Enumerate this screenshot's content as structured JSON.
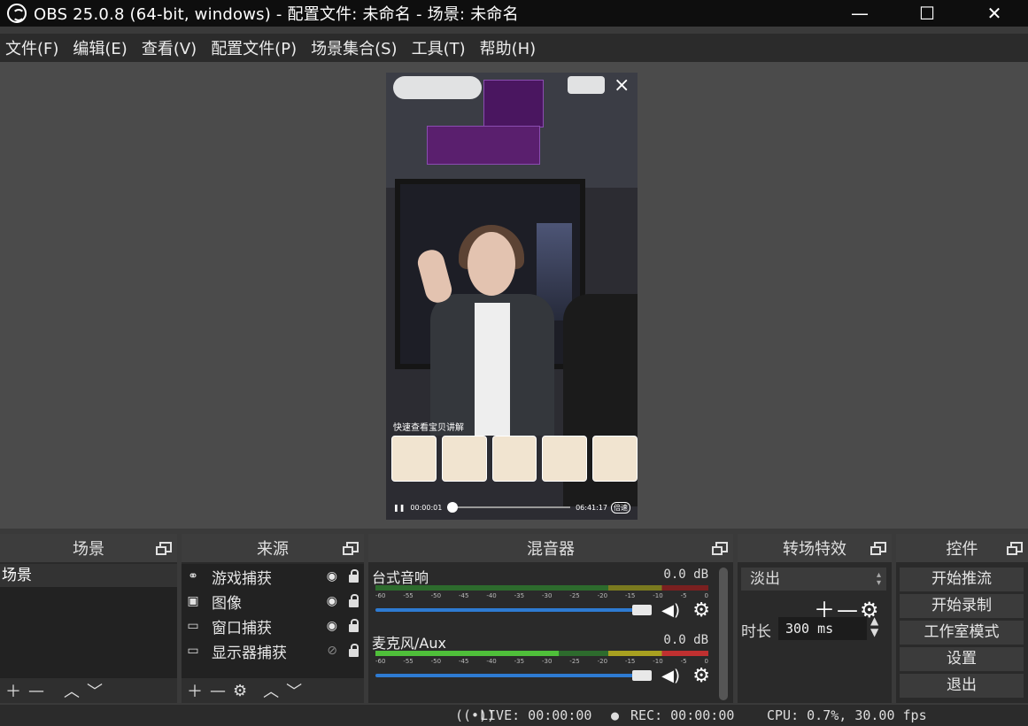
{
  "window": {
    "title": "OBS 25.0.8 (64-bit, windows) - 配置文件: 未命名 - 场景: 未命名",
    "minimize": "—",
    "maximize": "☐",
    "close": "✕"
  },
  "menu": [
    "文件(F)",
    "编辑(E)",
    "查看(V)",
    "配置文件(P)",
    "场景集合(S)",
    "工具(T)",
    "帮助(H)"
  ],
  "preview": {
    "caption": "快速查看宝贝讲解",
    "time_current": "00:00:01",
    "time_total": "06:41:17",
    "speed": "倍速",
    "progress": 0.0
  },
  "docks": {
    "scenes": {
      "title": "场景",
      "items": [
        "场景"
      ]
    },
    "sources": {
      "title": "来源",
      "items": [
        {
          "name": "游戏捕获",
          "icon": "gamepad-icon",
          "visible": true
        },
        {
          "name": "图像",
          "icon": "image-icon",
          "visible": true
        },
        {
          "name": "窗口捕获",
          "icon": "window-icon",
          "visible": true
        },
        {
          "name": "显示器捕获",
          "icon": "monitor-icon",
          "visible": false
        }
      ]
    },
    "mixer": {
      "title": "混音器",
      "channels": [
        {
          "name": "台式音响",
          "db": "0.0 dB",
          "level": 0.0,
          "volume": 1.0
        },
        {
          "name": "麦克风/Aux",
          "db": "0.0 dB",
          "level": 0.55,
          "volume": 1.0
        }
      ],
      "ticks": [
        "-60",
        "-55",
        "-50",
        "-45",
        "-40",
        "-35",
        "-30",
        "-25",
        "-20",
        "-15",
        "-10",
        "-5",
        "0"
      ]
    },
    "transitions": {
      "title": "转场特效",
      "selected": "淡出",
      "duration_label": "时长",
      "duration": "300 ms"
    },
    "controls": {
      "title": "控件",
      "buttons": [
        "开始推流",
        "开始录制",
        "工作室模式",
        "设置",
        "退出"
      ]
    }
  },
  "status": {
    "live": "LIVE: 00:00:00",
    "rec": "REC: 00:00:00",
    "cpu": "CPU: 0.7%, 30.00 fps"
  }
}
